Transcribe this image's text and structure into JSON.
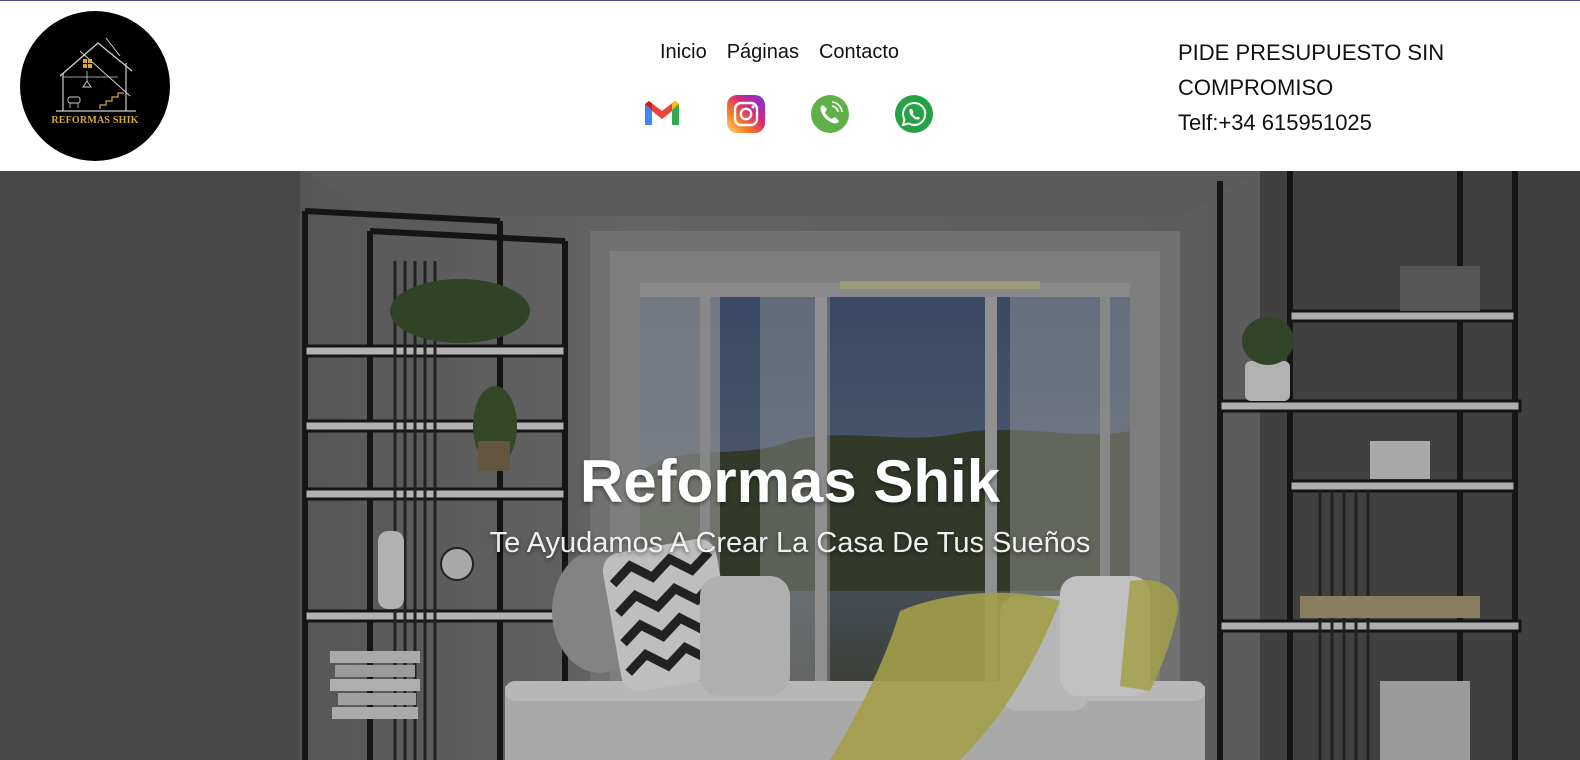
{
  "brand": {
    "name": "REFORMAS SHIK",
    "logo_bg": "#000000",
    "logo_accent": "#d4a647"
  },
  "nav": {
    "items": [
      {
        "label": "Inicio"
      },
      {
        "label": "Páginas"
      },
      {
        "label": "Contacto"
      }
    ]
  },
  "social": [
    {
      "name": "gmail-icon"
    },
    {
      "name": "instagram-icon"
    },
    {
      "name": "phone-icon"
    },
    {
      "name": "whatsapp-icon"
    }
  ],
  "contact": {
    "quote_line1": "PIDE PRESUPUESTO SIN",
    "quote_line2": "COMPROMISO",
    "phone": "Telf:+34 615951025"
  },
  "hero": {
    "title": "Reformas Shik",
    "subtitle": "Te Ayudamos A Crear La Casa De Tus Sueños",
    "overlay_color": "#000000"
  }
}
